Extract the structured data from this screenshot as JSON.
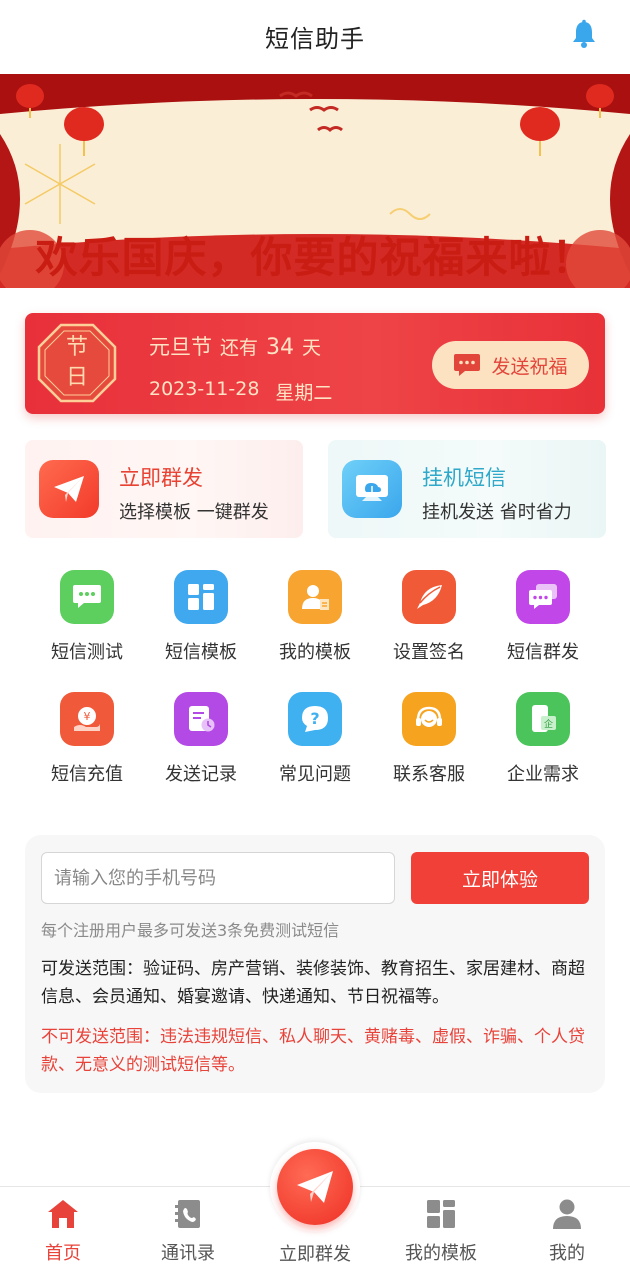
{
  "header": {
    "title": "短信助手",
    "icon": "bell-icon"
  },
  "banner": {
    "headline": "欢乐国庆，你要的祝福来啦！",
    "page_count": 2
  },
  "holiday": {
    "badge_top": "节",
    "badge_bottom": "日",
    "name": "元旦节",
    "remaining_label": "还有",
    "days": "34",
    "days_unit": "天",
    "date": "2023-11-28",
    "weekday": "星期二",
    "send_label": "发送祝福"
  },
  "features": [
    {
      "title": "立即群发",
      "subtitle": "选择模板 一键群发",
      "icon": "paper-plane-icon"
    },
    {
      "title": "挂机短信",
      "subtitle": "挂机发送 省时省力",
      "icon": "monitor-cloud-icon"
    }
  ],
  "grid": [
    {
      "label": "短信测试",
      "icon": "chat-bubble-icon",
      "color": "#5ccf5e"
    },
    {
      "label": "短信模板",
      "icon": "template-grid-icon",
      "color": "#3fa8ee"
    },
    {
      "label": "我的模板",
      "icon": "user-card-icon",
      "color": "#f7a431"
    },
    {
      "label": "设置签名",
      "icon": "feather-pen-icon",
      "color": "#f05a36"
    },
    {
      "label": "短信群发",
      "icon": "group-message-icon",
      "color": "#c147e8"
    },
    {
      "label": "短信充值",
      "icon": "recharge-icon",
      "color": "#f05a3a"
    },
    {
      "label": "发送记录",
      "icon": "record-clock-icon",
      "color": "#b34ae6"
    },
    {
      "label": "常见问题",
      "icon": "question-icon",
      "color": "#3fb0f0"
    },
    {
      "label": "联系客服",
      "icon": "headset-icon",
      "color": "#f6a31f"
    },
    {
      "label": "企业需求",
      "icon": "enterprise-phone-icon",
      "color": "#4cc45c"
    }
  ],
  "test_panel": {
    "phone_placeholder": "请输入您的手机号码",
    "phone_value": "",
    "try_label": "立即体验",
    "note": "每个注册用户最多可发送3条免费测试短信",
    "allowed": "可发送范围：验证码、房产营销、装修装饰、教育招生、家居建材、商超信息、会员通知、婚宴邀请、快递通知、节日祝福等。",
    "forbidden": "不可发送范围：违法违规短信、私人聊天、黄赌毒、虚假、诈骗、个人贷款、无意义的测试短信等。"
  },
  "tabbar": {
    "home": "首页",
    "contacts": "通讯录",
    "send": "立即群发",
    "templates": "我的模板",
    "mine": "我的",
    "active": "home"
  },
  "colors": {
    "accent": "#e8433a",
    "holiday_bg": "#e8303a",
    "info": "#2fa8c9"
  }
}
